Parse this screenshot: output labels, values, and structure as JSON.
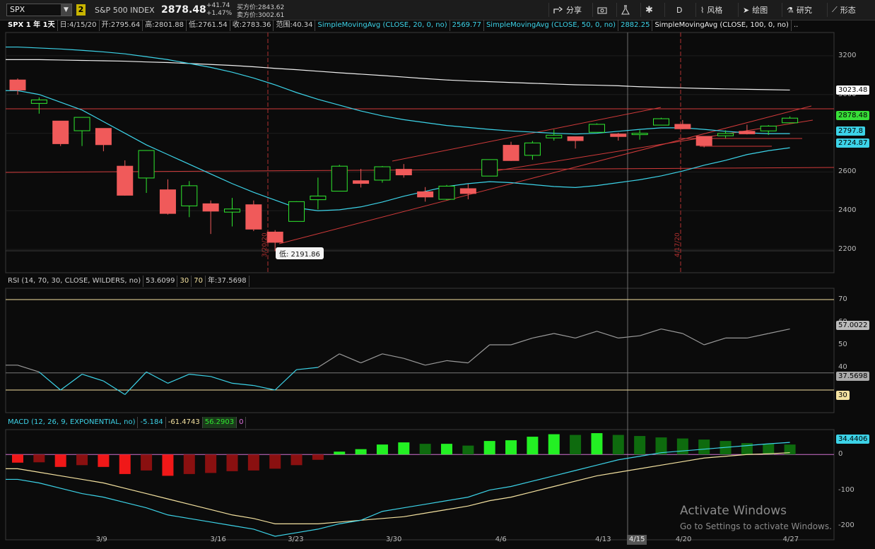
{
  "toolbar": {
    "symbol": "SPX",
    "badge": "2",
    "index_name": "S&P 500 INDEX",
    "last": "2878.48",
    "change": "+41.74",
    "change_pct": "+1.47%",
    "bid_label": "买方价:2843.62",
    "ask_label": "卖方价:3002.61",
    "buttons": {
      "share": "分享",
      "aggregation": "D",
      "style": "风格",
      "drawing": "绘图",
      "studies": "研究",
      "patterns": "形态"
    }
  },
  "studies_header": {
    "label": "SPX 1 年 1天",
    "date": "日:4/15/20",
    "open": "开:2795.64",
    "high": "高:2801.88",
    "low": "低:2761.54",
    "close": "收:2783.36",
    "range": "范围:40.34",
    "sma20_name": "SimpleMovingAvg (CLOSE, 20, 0, no)",
    "sma20_val": "2569.77",
    "sma50_name": "SimpleMovingAvg (CLOSE, 50, 0, no)",
    "sma50_val": "2882.25",
    "sma100_name": "SimpleMovingAvg (CLOSE, 100, 0, no)",
    "more": ".."
  },
  "price_axis": {
    "ticks": [
      "3200",
      "3000",
      "2800",
      "2600",
      "2400",
      "2200"
    ],
    "sma100_label": "3023.48",
    "last_label": "2878.48",
    "sma50_label": "2797.8",
    "sma20_label": "2724.87"
  },
  "annotations": {
    "low_bubble": "低: 2191.86",
    "vline1_date": "3/20/20",
    "vline2_date": "4/17/20",
    "cursor_date": "4/15"
  },
  "rsi": {
    "name": "RSI (14, 70, 30, CLOSE, WILDERS, no)",
    "value": "53.6099",
    "ob_level": "30",
    "os_level": "70",
    "year_val": "年:37.5698",
    "ticks": [
      "70",
      "60",
      "50",
      "40"
    ],
    "label_cur": "57.0022",
    "label_year": "37.5698",
    "label_30": "30"
  },
  "macd": {
    "name": "MACD (12, 26, 9, EXPONENTIAL, no)",
    "v1": "-5.184",
    "v2": "-61.4743",
    "v3": "56.2903",
    "v4": "0",
    "ticks": [
      "0",
      "-100",
      "-200"
    ],
    "label_cur": "34.4406"
  },
  "x_axis": {
    "labels": [
      "3/9",
      "3/16",
      "3/23",
      "3/30",
      "4/6",
      "4/13",
      "4/20",
      "4/27"
    ]
  },
  "watermark": {
    "line1": "Activate Windows",
    "line2": "Go to Settings to activate Windows."
  },
  "colors": {
    "up": "#2fe82f",
    "down": "#f05a5a",
    "sma20": "#3cd3e8",
    "sma50": "#3cd3e8",
    "sma100": "#f0f0f0",
    "macd_signal": "#f4e2a0"
  },
  "chart_data": {
    "type": "candlestick",
    "x": [
      "3/5",
      "3/6",
      "3/9",
      "3/10",
      "3/11",
      "3/12",
      "3/13",
      "3/16",
      "3/17",
      "3/18",
      "3/19",
      "3/20",
      "3/23",
      "3/24",
      "3/25",
      "3/26",
      "3/27",
      "3/30",
      "3/31",
      "4/1",
      "4/2",
      "4/3",
      "4/6",
      "4/7",
      "4/8",
      "4/9",
      "4/13",
      "4/14",
      "4/15",
      "4/16",
      "4/17",
      "4/20",
      "4/21",
      "4/22",
      "4/23",
      "4/24",
      "4/27"
    ],
    "candles": [
      {
        "o": 3075,
        "h": 3083,
        "l": 2999,
        "c": 3023
      },
      {
        "o": 2954,
        "h": 2985,
        "l": 2901,
        "c": 2972
      },
      {
        "o": 2863,
        "h": 2863,
        "l": 2734,
        "c": 2746
      },
      {
        "o": 2813,
        "h": 2882,
        "l": 2734,
        "c": 2882
      },
      {
        "o": 2825,
        "h": 2825,
        "l": 2707,
        "c": 2741
      },
      {
        "o": 2630,
        "h": 2660,
        "l": 2478,
        "c": 2480
      },
      {
        "o": 2569,
        "h": 2711,
        "l": 2492,
        "c": 2711
      },
      {
        "o": 2508,
        "h": 2562,
        "l": 2380,
        "c": 2386
      },
      {
        "o": 2425,
        "h": 2553,
        "l": 2367,
        "c": 2529
      },
      {
        "o": 2436,
        "h": 2453,
        "l": 2280,
        "c": 2398
      },
      {
        "o": 2393,
        "h": 2466,
        "l": 2319,
        "c": 2409
      },
      {
        "o": 2431,
        "h": 2453,
        "l": 2295,
        "c": 2305
      },
      {
        "o": 2290,
        "h": 2300,
        "l": 2191,
        "c": 2237
      },
      {
        "o": 2345,
        "h": 2449,
        "l": 2345,
        "c": 2447
      },
      {
        "o": 2457,
        "h": 2571,
        "l": 2407,
        "c": 2476
      },
      {
        "o": 2501,
        "h": 2637,
        "l": 2500,
        "c": 2630
      },
      {
        "o": 2555,
        "h": 2616,
        "l": 2520,
        "c": 2541
      },
      {
        "o": 2558,
        "h": 2631,
        "l": 2545,
        "c": 2627
      },
      {
        "o": 2614,
        "h": 2641,
        "l": 2571,
        "c": 2585
      },
      {
        "o": 2498,
        "h": 2522,
        "l": 2447,
        "c": 2471
      },
      {
        "o": 2459,
        "h": 2533,
        "l": 2455,
        "c": 2527
      },
      {
        "o": 2514,
        "h": 2538,
        "l": 2459,
        "c": 2489
      },
      {
        "o": 2579,
        "h": 2665,
        "l": 2579,
        "c": 2664
      },
      {
        "o": 2738,
        "h": 2756,
        "l": 2657,
        "c": 2659
      },
      {
        "o": 2686,
        "h": 2760,
        "l": 2663,
        "c": 2750
      },
      {
        "o": 2776,
        "h": 2819,
        "l": 2762,
        "c": 2790
      },
      {
        "o": 2782,
        "h": 2783,
        "l": 2721,
        "c": 2762
      },
      {
        "o": 2805,
        "h": 2851,
        "l": 2805,
        "c": 2846
      },
      {
        "o": 2796,
        "h": 2802,
        "l": 2762,
        "c": 2783
      },
      {
        "o": 2800,
        "h": 2816,
        "l": 2767,
        "c": 2800
      },
      {
        "o": 2842,
        "h": 2880,
        "l": 2842,
        "c": 2875
      },
      {
        "o": 2846,
        "h": 2868,
        "l": 2821,
        "c": 2823
      },
      {
        "o": 2784,
        "h": 2785,
        "l": 2727,
        "c": 2737
      },
      {
        "o": 2787,
        "h": 2815,
        "l": 2775,
        "c": 2799
      },
      {
        "o": 2810,
        "h": 2844,
        "l": 2794,
        "c": 2797
      },
      {
        "o": 2812,
        "h": 2842,
        "l": 2791,
        "c": 2837
      },
      {
        "o": 2854,
        "h": 2887,
        "l": 2852,
        "c": 2878
      }
    ],
    "sma20": [
      3020,
      3000,
      2960,
      2920,
      2860,
      2800,
      2740,
      2690,
      2640,
      2590,
      2540,
      2495,
      2455,
      2415,
      2400,
      2405,
      2420,
      2445,
      2475,
      2500,
      2525,
      2540,
      2550,
      2545,
      2535,
      2525,
      2520,
      2530,
      2545,
      2560,
      2580,
      2605,
      2635,
      2660,
      2690,
      2710,
      2725
    ],
    "sma50": [
      3245,
      3240,
      3235,
      3228,
      3220,
      3210,
      3195,
      3180,
      3160,
      3140,
      3115,
      3085,
      3050,
      3010,
      2975,
      2945,
      2915,
      2890,
      2870,
      2855,
      2840,
      2830,
      2820,
      2812,
      2806,
      2800,
      2796,
      2800,
      2810,
      2820,
      2828,
      2828,
      2820,
      2810,
      2802,
      2798,
      2798
    ],
    "sma100": [
      3180,
      3180,
      3178,
      3176,
      3174,
      3172,
      3168,
      3165,
      3160,
      3155,
      3150,
      3143,
      3135,
      3128,
      3120,
      3112,
      3105,
      3098,
      3090,
      3082,
      3075,
      3070,
      3066,
      3062,
      3058,
      3054,
      3050,
      3048,
      3045,
      3040,
      3037,
      3034,
      3031,
      3029,
      3027,
      3025,
      3023
    ],
    "rsi": [
      41,
      38,
      30,
      37,
      34,
      28,
      38,
      33,
      37,
      36,
      33,
      32,
      30,
      39,
      40,
      46,
      42,
      46,
      44,
      41,
      43,
      42,
      50,
      50,
      53,
      55,
      53,
      56,
      53,
      54,
      57,
      55,
      50,
      53,
      53,
      55,
      57
    ],
    "macd_hist": [
      -23,
      -22,
      -35,
      -30,
      -35,
      -55,
      -45,
      -60,
      -55,
      -52,
      -47,
      -45,
      -40,
      -30,
      -15,
      8,
      15,
      28,
      34,
      30,
      30,
      25,
      38,
      40,
      50,
      57,
      55,
      60,
      55,
      52,
      48,
      45,
      42,
      38,
      32,
      30,
      28
    ],
    "macd_line": [
      -70,
      -80,
      -95,
      -110,
      -120,
      -135,
      -150,
      -170,
      -180,
      -190,
      -200,
      -210,
      -230,
      -220,
      -210,
      -195,
      -185,
      -160,
      -150,
      -140,
      -130,
      -120,
      -100,
      -90,
      -75,
      -60,
      -45,
      -30,
      -15,
      -5,
      5,
      10,
      15,
      20,
      25,
      30,
      34
    ],
    "macd_signal": [
      -40,
      -50,
      -60,
      -70,
      -80,
      -95,
      -110,
      -125,
      -140,
      -155,
      -170,
      -180,
      -195,
      -195,
      -195,
      -190,
      -185,
      -180,
      -175,
      -165,
      -155,
      -145,
      -130,
      -120,
      -105,
      -90,
      -75,
      -60,
      -50,
      -40,
      -30,
      -20,
      -10,
      -5,
      0,
      2,
      5
    ],
    "price_ylim": [
      2080,
      3320
    ],
    "rsi_ylim": [
      20,
      75
    ],
    "macd_ylim": [
      -240,
      70
    ]
  }
}
